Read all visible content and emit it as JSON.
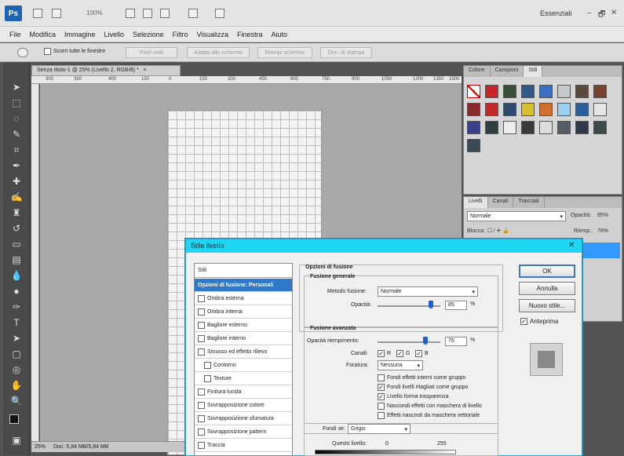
{
  "app": {
    "logo": "Ps",
    "workspace": "Essenziali",
    "zoom_level": "100%",
    "window_controls": [
      "–",
      "🗗",
      "✕"
    ]
  },
  "menu": [
    "File",
    "Modifica",
    "Immagine",
    "Livello",
    "Selezione",
    "Filtro",
    "Visualizza",
    "Finestra",
    "Aiuto"
  ],
  "options_bar": {
    "scroll_all": "Scorri tutte le finestre",
    "buttons": [
      "Pixel reali",
      "Adatta allo schermo",
      "Riempi schermo",
      "Dim. di stampa"
    ]
  },
  "document": {
    "tab_title": "Senza titolo-1 @ 25% (Livello 2, RGB/8) *",
    "tab_close": "×",
    "ruler_labels": [
      "300",
      "350",
      "400",
      "150",
      "0",
      "150",
      "300",
      "450",
      "600",
      "750",
      "900",
      "1050",
      "1200",
      "1350",
      "1500"
    ],
    "status_zoom": "25%",
    "status_doc": "Doc: 5,84 MB/5,84 MB"
  },
  "styles_panel": {
    "tabs": [
      "Colore",
      "Campioni",
      "Stili"
    ],
    "active_tab": "Stili"
  },
  "layers_panel": {
    "tabs": [
      "Livelli",
      "Canali",
      "Tracciati"
    ],
    "blend_mode": "Normale",
    "opacity_label": "Opacità:",
    "opacity_value": "85%",
    "lock_label": "Blocca:",
    "fill_label": "Riemp.:",
    "fill_value": "76%"
  },
  "dialog": {
    "title": "Stile livello",
    "close": "✕",
    "list_header": "Stili",
    "items": [
      {
        "label": "Opzioni di fusione: Personali",
        "selected": true,
        "checkbox": false,
        "sub": false
      },
      {
        "label": "Ombra esterna",
        "selected": false,
        "checkbox": true,
        "sub": false
      },
      {
        "label": "Ombra interna",
        "selected": false,
        "checkbox": true,
        "sub": false
      },
      {
        "label": "Bagliore esterno",
        "selected": false,
        "checkbox": true,
        "sub": false
      },
      {
        "label": "Bagliore interno",
        "selected": false,
        "checkbox": true,
        "sub": false
      },
      {
        "label": "Smusso ed effetto rilievo",
        "selected": false,
        "checkbox": true,
        "sub": false
      },
      {
        "label": "Contorno",
        "selected": false,
        "checkbox": true,
        "sub": true
      },
      {
        "label": "Texture",
        "selected": false,
        "checkbox": true,
        "sub": true
      },
      {
        "label": "Finitura lucida",
        "selected": false,
        "checkbox": true,
        "sub": false
      },
      {
        "label": "Sovrapposizione colore",
        "selected": false,
        "checkbox": true,
        "sub": false
      },
      {
        "label": "Sovrapposizione sfumatura",
        "selected": false,
        "checkbox": true,
        "sub": false
      },
      {
        "label": "Sovrapposizione pattern",
        "selected": false,
        "checkbox": true,
        "sub": false
      },
      {
        "label": "Traccia",
        "selected": false,
        "checkbox": true,
        "sub": false
      }
    ],
    "blend_options_title": "Opzioni di fusione",
    "general_title": "Fusione generale",
    "blend_mode_label": "Metodo fusione:",
    "blend_mode_value": "Normale",
    "opacity_label": "Opacità:",
    "opacity_value": "85",
    "opacity_fraction": 0.85,
    "advanced_title": "Fusione avanzata",
    "fill_opacity_label": "Opacità riempimento:",
    "fill_opacity_value": "76",
    "fill_opacity_fraction": 0.76,
    "percent": "%",
    "channels_label": "Canali:",
    "channels": [
      "R",
      "G",
      "B"
    ],
    "knockout_label": "Foratura:",
    "knockout_value": "Nessuna",
    "advanced_checks": [
      {
        "label": "Fondi effetti interni come gruppo",
        "checked": false
      },
      {
        "label": "Fondi livelli ritagliati come gruppo",
        "checked": true
      },
      {
        "label": "Livello forma trasparenza",
        "checked": true
      },
      {
        "label": "Nascondi effetti con maschera di livello",
        "checked": false
      },
      {
        "label": "Effetti nascosti da maschera vettoriale",
        "checked": false
      }
    ],
    "blend_if_label": "Fondi se:",
    "blend_if_value": "Grigio",
    "this_layer_label": "Questo livello:",
    "this_layer_min": "0",
    "this_layer_max": "255",
    "ok": "OK",
    "cancel": "Annulla",
    "new_style": "Nuovo stile...",
    "preview": "Anteprima"
  }
}
